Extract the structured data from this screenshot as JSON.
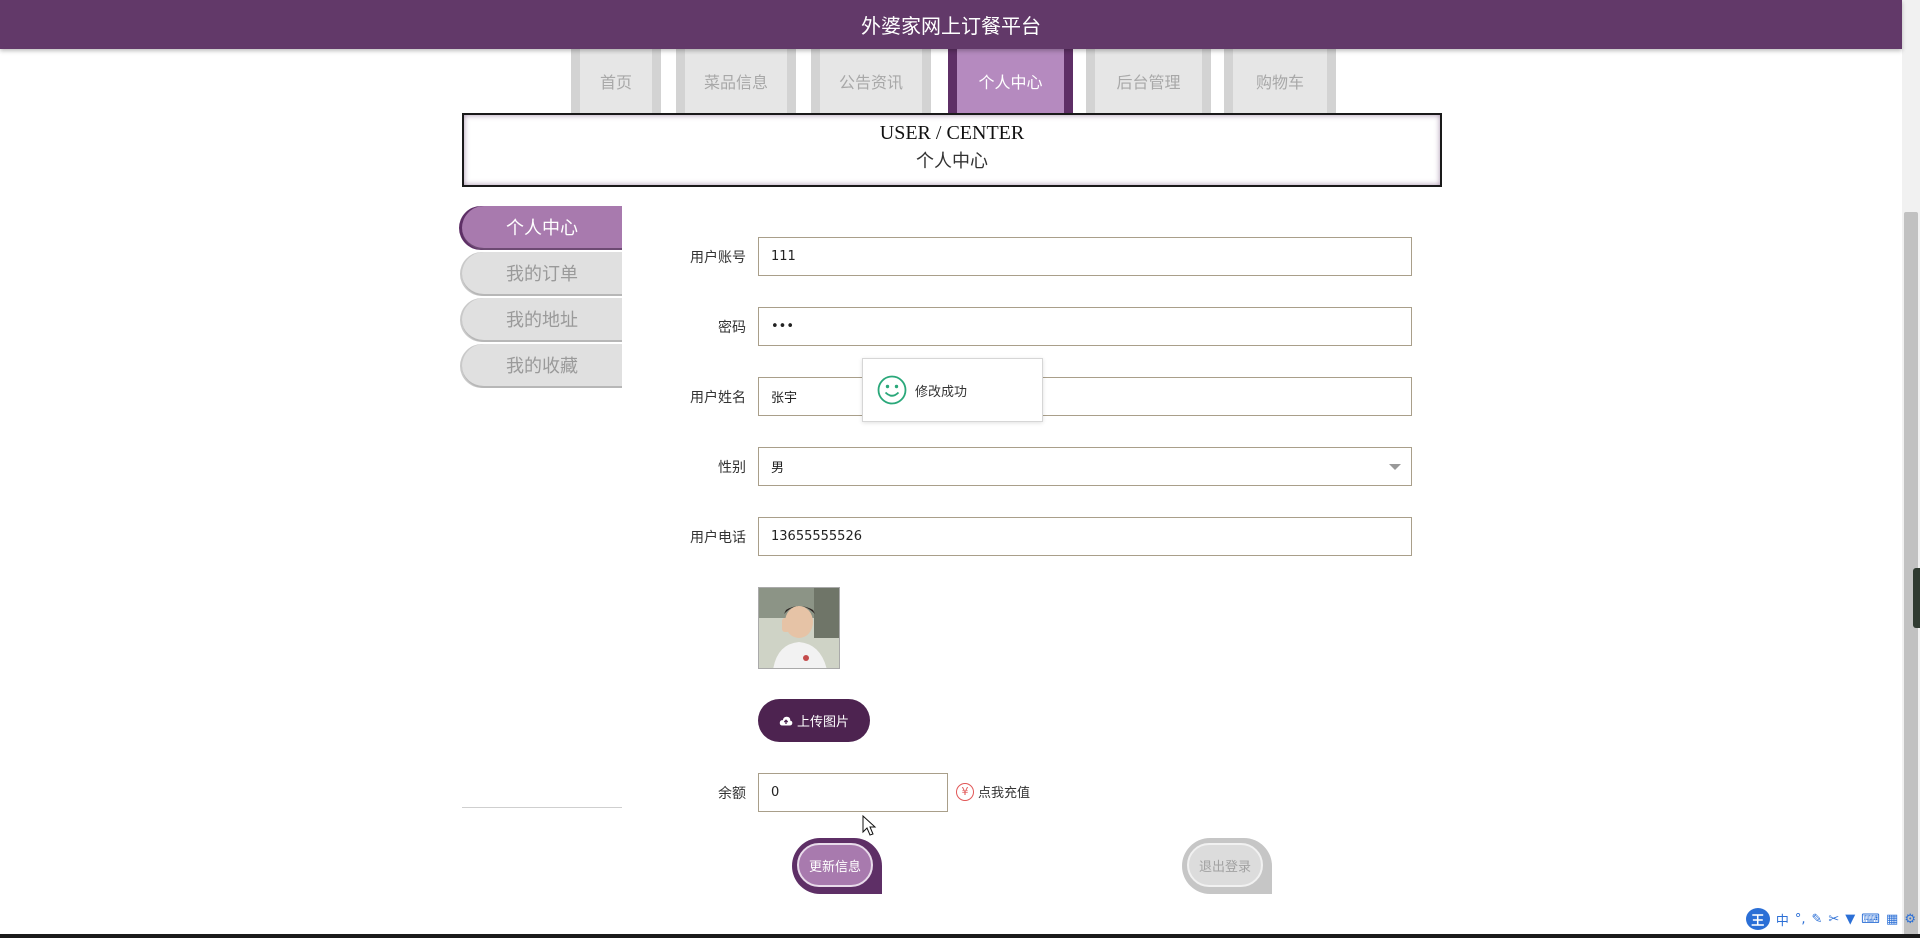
{
  "header": {
    "title": "外婆家网上订餐平台"
  },
  "nav": {
    "items": [
      {
        "label": "首页"
      },
      {
        "label": "菜品信息"
      },
      {
        "label": "公告资讯"
      },
      {
        "label": "个人中心"
      },
      {
        "label": "后台管理"
      },
      {
        "label": "购物车"
      }
    ],
    "active_index": 3
  },
  "banner": {
    "en": "USER / CENTER",
    "cn": "个人中心"
  },
  "sidebar": {
    "items": [
      {
        "label": "个人中心"
      },
      {
        "label": "我的订单"
      },
      {
        "label": "我的地址"
      },
      {
        "label": "我的收藏"
      }
    ],
    "active_index": 0
  },
  "form": {
    "account": {
      "label": "用户账号",
      "value": "111"
    },
    "password": {
      "label": "密码",
      "value": "•••"
    },
    "name": {
      "label": "用户姓名",
      "value": "张宇"
    },
    "gender": {
      "label": "性别",
      "value": "男"
    },
    "phone": {
      "label": "用户电话",
      "value": "13655555526"
    },
    "upload_label": "上传图片",
    "balance": {
      "label": "余额",
      "value": "0"
    },
    "recharge_label": "点我充值",
    "recharge_symbol": "¥"
  },
  "actions": {
    "update_label": "更新信息",
    "logout_label": "退出登录"
  },
  "toast": {
    "message": "修改成功"
  },
  "ime": {
    "logo": "王",
    "mode": "中"
  },
  "colors": {
    "primary": "#623969",
    "accent": "#a87aae",
    "dark": "#4d2350",
    "success": "#2aa87a"
  }
}
